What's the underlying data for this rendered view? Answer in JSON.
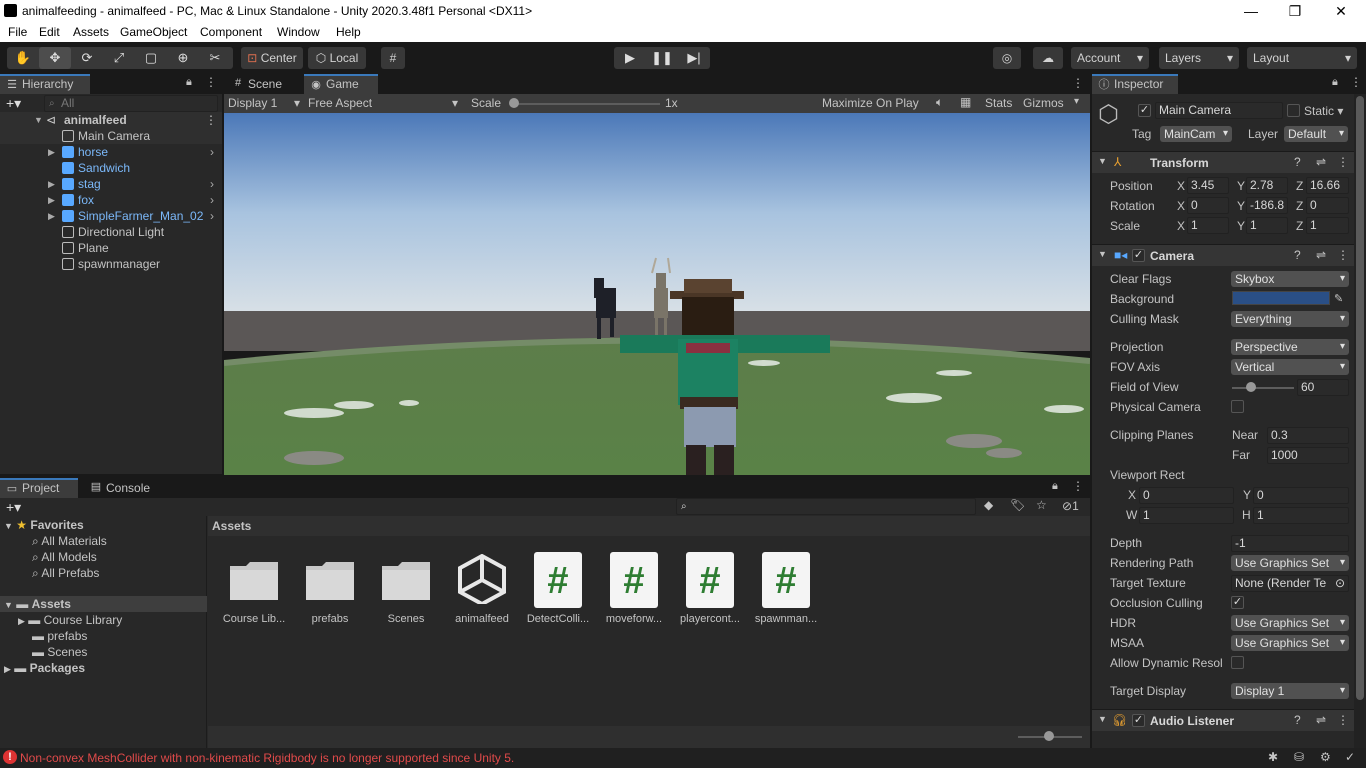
{
  "window": {
    "title": "animalfeeding - animalfeed - PC, Mac & Linux Standalone - Unity 2020.3.48f1 Personal <DX11>"
  },
  "menu": [
    "File",
    "Edit",
    "Assets",
    "GameObject",
    "Component",
    "Window",
    "Help"
  ],
  "toolbar": {
    "pivot": "Center",
    "space": "Local",
    "account": "Account",
    "layers": "Layers",
    "layout": "Layout"
  },
  "hierarchy": {
    "tab": "Hierarchy",
    "search_placeholder": "All",
    "scene": "animalfeed",
    "items": [
      {
        "label": "Main Camera",
        "prefab": false,
        "expandable": false
      },
      {
        "label": "horse",
        "prefab": true,
        "expandable": true
      },
      {
        "label": "Sandwich",
        "prefab": true,
        "expandable": false
      },
      {
        "label": "stag",
        "prefab": true,
        "expandable": true
      },
      {
        "label": "fox",
        "prefab": true,
        "expandable": true
      },
      {
        "label": "SimpleFarmer_Man_02",
        "prefab": true,
        "expandable": true
      },
      {
        "label": "Directional Light",
        "prefab": false,
        "expandable": false
      },
      {
        "label": "Plane",
        "prefab": false,
        "expandable": false
      },
      {
        "label": "spawnmanager",
        "prefab": false,
        "expandable": false
      }
    ]
  },
  "game": {
    "tabs": [
      "Scene",
      "Game"
    ],
    "display": "Display 1",
    "aspect": "Free Aspect",
    "scale_label": "Scale",
    "scale_value": "1x",
    "maximize": "Maximize On Play",
    "stats": "Stats",
    "gizmos": "Gizmos"
  },
  "inspector": {
    "tab": "Inspector",
    "object_name": "Main Camera",
    "static_label": "Static",
    "tag_label": "Tag",
    "tag": "MainCam",
    "layer_label": "Layer",
    "layer": "Default",
    "transform": {
      "title": "Transform",
      "position_label": "Position",
      "position": {
        "x": "3.45",
        "y": "2.78",
        "z": "16.66"
      },
      "rotation_label": "Rotation",
      "rotation": {
        "x": "0",
        "y": "-186.8",
        "z": "0"
      },
      "scale_label": "Scale",
      "scale": {
        "x": "1",
        "y": "1",
        "z": "1"
      }
    },
    "camera": {
      "title": "Camera",
      "clear_flags_label": "Clear Flags",
      "clear_flags": "Skybox",
      "background_label": "Background",
      "background_color": "#2a4f86",
      "culling_label": "Culling Mask",
      "culling": "Everything",
      "projection_label": "Projection",
      "projection": "Perspective",
      "fov_axis_label": "FOV Axis",
      "fov_axis": "Vertical",
      "fov_label": "Field of View",
      "fov": "60",
      "fov_fraction": 0.3,
      "physical_label": "Physical Camera",
      "clipping_label": "Clipping Planes",
      "near_label": "Near",
      "near": "0.3",
      "far_label": "Far",
      "far": "1000",
      "viewport_label": "Viewport Rect",
      "vx": "0",
      "vy": "0",
      "vw": "1",
      "vh": "1",
      "depth_label": "Depth",
      "depth": "-1",
      "rendering_label": "Rendering Path",
      "rendering": "Use Graphics Set",
      "target_tex_label": "Target Texture",
      "target_tex": "None (Render Te",
      "occlusion_label": "Occlusion Culling",
      "hdr_label": "HDR",
      "hdr": "Use Graphics Set",
      "msaa_label": "MSAA",
      "msaa": "Use Graphics Set",
      "dyn_label": "Allow Dynamic Resol",
      "target_display_label": "Target Display",
      "target_display": "Display 1"
    },
    "audio": {
      "title": "Audio Listener"
    }
  },
  "project": {
    "tabs": [
      "Project",
      "Console"
    ],
    "favorites": "Favorites",
    "fav_items": [
      "All Materials",
      "All Models",
      "All Prefabs"
    ],
    "assets_label": "Assets",
    "asset_folders": [
      "Course Library",
      "prefabs",
      "Scenes"
    ],
    "packages": "Packages",
    "breadcrumb": "Assets",
    "hidden_count": "1",
    "grid": [
      {
        "name": "Course Lib...",
        "kind": "folder"
      },
      {
        "name": "prefabs",
        "kind": "folder"
      },
      {
        "name": "Scenes",
        "kind": "folder"
      },
      {
        "name": "animalfeed",
        "kind": "unity"
      },
      {
        "name": "DetectColli...",
        "kind": "script"
      },
      {
        "name": "moveforw...",
        "kind": "script"
      },
      {
        "name": "playercont...",
        "kind": "script"
      },
      {
        "name": "spawnman...",
        "kind": "script"
      }
    ]
  },
  "status": {
    "error": "Non-convex MeshCollider with non-kinematic Rigidbody is no longer supported since Unity 5."
  }
}
